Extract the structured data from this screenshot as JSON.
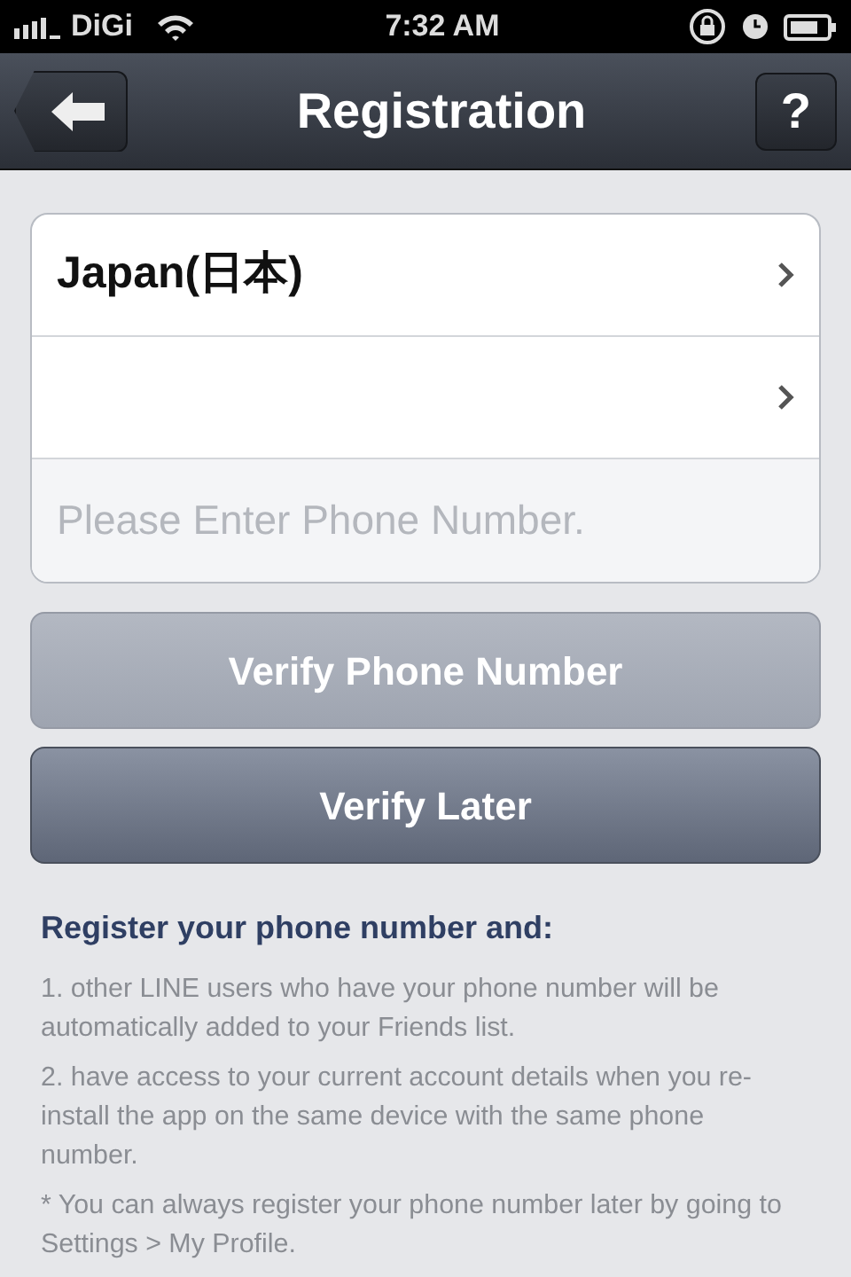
{
  "status_bar": {
    "carrier": "DiGi",
    "time": "7:32 AM"
  },
  "nav": {
    "title": "Registration",
    "help": "?"
  },
  "form": {
    "rows": [
      {
        "kind": "select",
        "value": "Japan(日本)"
      },
      {
        "kind": "select",
        "value": ""
      },
      {
        "kind": "input",
        "placeholder": "Please Enter Phone Number."
      }
    ]
  },
  "buttons": [
    {
      "label": "Verify Phone Number",
      "disabled": true
    },
    {
      "label": "Verify Later",
      "disabled": false
    }
  ],
  "info": {
    "heading": "Register your phone number and:",
    "paragraphs": [
      "1. other LINE users who have your phone number will be automatically added to your Friends list.",
      "2. have access to your current account details when you re-install the app on the same device with the same phone number.",
      "* You can always register your phone number later by going to Settings > My Profile."
    ]
  }
}
